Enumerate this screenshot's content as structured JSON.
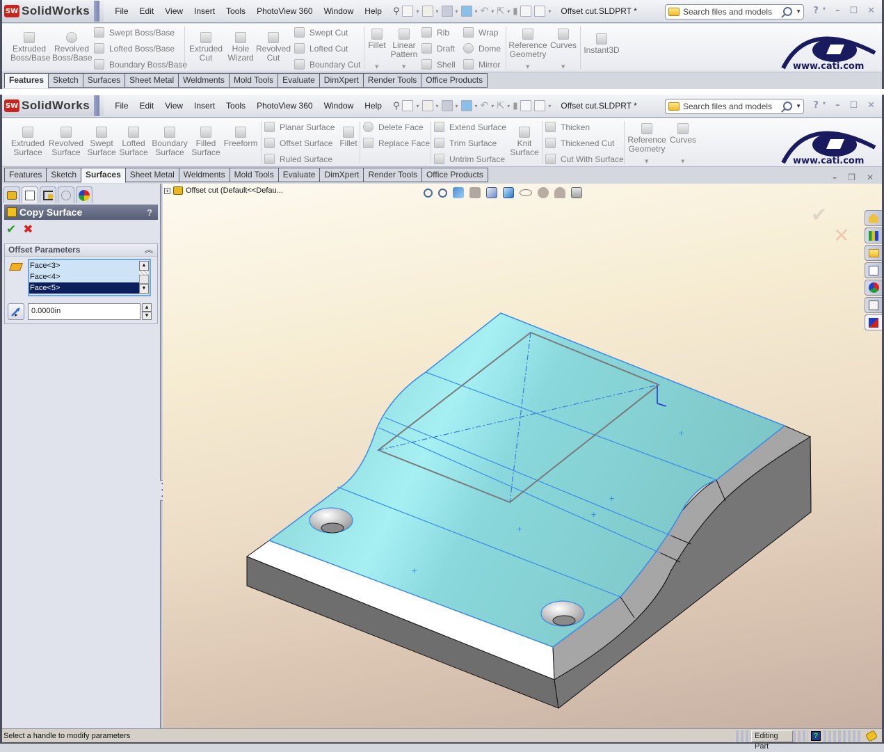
{
  "app": {
    "name": "SolidWorks",
    "logo_badge": "SW",
    "menu": [
      "File",
      "Edit",
      "View",
      "Insert",
      "Tools",
      "PhotoView 360",
      "Window",
      "Help"
    ],
    "document_title": "Offset cut.SLDPRT *",
    "search_placeholder": "Search files and models",
    "help_label": "?",
    "watermark": "www.cati.com"
  },
  "top_window": {
    "ribbon": {
      "large_buttons_left": [
        {
          "label": "Extruded Boss/Base",
          "icon": "extruded-boss-icon"
        },
        {
          "label": "Revolved Boss/Base",
          "icon": "revolved-boss-icon"
        }
      ],
      "stack_boss": [
        {
          "label": "Swept Boss/Base",
          "icon": "swept-boss-icon"
        },
        {
          "label": "Lofted Boss/Base",
          "icon": "lofted-boss-icon"
        },
        {
          "label": "Boundary Boss/Base",
          "icon": "boundary-boss-icon"
        }
      ],
      "large_buttons_cut": [
        {
          "label": "Extruded Cut",
          "icon": "extruded-cut-icon"
        },
        {
          "label": "Hole Wizard",
          "icon": "hole-wizard-icon"
        },
        {
          "label": "Revolved Cut",
          "icon": "revolved-cut-icon"
        }
      ],
      "stack_cut": [
        {
          "label": "Swept Cut",
          "icon": "swept-cut-icon"
        },
        {
          "label": "Lofted Cut",
          "icon": "lofted-cut-icon"
        },
        {
          "label": "Boundary Cut",
          "icon": "boundary-cut-icon"
        }
      ],
      "large_buttons_feat": [
        {
          "label": "Fillet",
          "icon": "fillet-icon"
        },
        {
          "label": "Linear Pattern",
          "icon": "linear-pattern-icon"
        }
      ],
      "stack_feat1": [
        {
          "label": "Rib",
          "icon": "rib-icon"
        },
        {
          "label": "Draft",
          "icon": "draft-icon"
        },
        {
          "label": "Shell",
          "icon": "shell-icon"
        }
      ],
      "stack_feat2": [
        {
          "label": "Wrap",
          "icon": "wrap-icon"
        },
        {
          "label": "Dome",
          "icon": "dome-icon"
        },
        {
          "label": "Mirror",
          "icon": "mirror-icon"
        }
      ],
      "large_buttons_ref": [
        {
          "label": "Reference Geometry",
          "icon": "reference-geometry-icon"
        },
        {
          "label": "Curves",
          "icon": "curves-icon"
        },
        {
          "label": "Instant3D",
          "icon": "instant3d-icon"
        }
      ]
    },
    "tabs": [
      {
        "label": "Features",
        "active": true
      },
      {
        "label": "Sketch"
      },
      {
        "label": "Surfaces"
      },
      {
        "label": "Sheet Metal"
      },
      {
        "label": "Weldments"
      },
      {
        "label": "Mold Tools"
      },
      {
        "label": "Evaluate"
      },
      {
        "label": "DimXpert"
      },
      {
        "label": "Render Tools"
      },
      {
        "label": "Office Products"
      }
    ]
  },
  "main_window": {
    "ribbon": {
      "large_buttons": [
        {
          "label": "Extruded Surface",
          "icon": "extruded-surface-icon"
        },
        {
          "label": "Revolved Surface",
          "icon": "revolved-surface-icon"
        },
        {
          "label": "Swept Surface",
          "icon": "swept-surface-icon"
        },
        {
          "label": "Lofted Surface",
          "icon": "lofted-surface-icon"
        },
        {
          "label": "Boundary Surface",
          "icon": "boundary-surface-icon"
        },
        {
          "label": "Filled Surface",
          "icon": "filled-surface-icon"
        },
        {
          "label": "Freeform",
          "icon": "freeform-icon"
        }
      ],
      "stack_surface": [
        {
          "label": "Planar Surface",
          "icon": "planar-surface-icon"
        },
        {
          "label": "Offset Surface",
          "icon": "offset-surface-icon"
        },
        {
          "label": "Ruled Surface",
          "icon": "ruled-surface-icon"
        }
      ],
      "fillet": {
        "label": "Fillet",
        "icon": "fillet-icon"
      },
      "stack_face": [
        {
          "label": "Delete Face",
          "icon": "delete-face-icon"
        },
        {
          "label": "Replace Face",
          "icon": "replace-face-icon"
        }
      ],
      "stack_trim": [
        {
          "label": "Extend Surface",
          "icon": "extend-surface-icon"
        },
        {
          "label": "Trim Surface",
          "icon": "trim-surface-icon"
        },
        {
          "label": "Untrim Surface",
          "icon": "untrim-surface-icon"
        }
      ],
      "knit": {
        "label": "Knit Surface",
        "icon": "knit-surface-icon"
      },
      "stack_thicken": [
        {
          "label": "Thicken",
          "icon": "thicken-icon"
        },
        {
          "label": "Thickened Cut",
          "icon": "thickened-cut-icon"
        },
        {
          "label": "Cut With Surface",
          "icon": "cut-with-surface-icon"
        }
      ],
      "ref": [
        {
          "label": "Reference Geometry",
          "icon": "reference-geometry-icon"
        },
        {
          "label": "Curves",
          "icon": "curves-icon"
        }
      ]
    },
    "tabs": [
      {
        "label": "Features"
      },
      {
        "label": "Sketch"
      },
      {
        "label": "Surfaces",
        "active": true
      },
      {
        "label": "Sheet Metal"
      },
      {
        "label": "Weldments"
      },
      {
        "label": "Mold Tools"
      },
      {
        "label": "Evaluate"
      },
      {
        "label": "DimXpert"
      },
      {
        "label": "Render Tools"
      },
      {
        "label": "Office Products"
      }
    ]
  },
  "property_manager": {
    "panel_tabs": [
      "feature-manager-tree-icon",
      "property-manager-icon",
      "configuration-manager-icon",
      "dimxpert-manager-icon",
      "display-manager-icon"
    ],
    "title": "Copy Surface",
    "help": "?",
    "ok_icon": "✔",
    "cancel_icon": "✖",
    "group_title": "Offset Parameters",
    "collapse_icon": "︽",
    "faces": [
      {
        "label": "Face<3>"
      },
      {
        "label": "Face<4>"
      },
      {
        "label": "Face<5>",
        "selected": true
      }
    ],
    "offset_value": "0.0000in"
  },
  "viewport": {
    "tree_root": "Offset cut  (Default<<Defau...",
    "heads_up_toolbar": [
      "zoom-to-fit-icon",
      "zoom-to-area-icon",
      "previous-view-icon",
      "section-view-icon",
      "view-orientation-icon",
      "display-style-icon",
      "hide-show-items-icon",
      "edit-appearance-icon",
      "apply-scene-icon",
      "view-settings-icon"
    ],
    "confirm_ok": "✔",
    "confirm_cancel": "✕",
    "task_pane": [
      "solidworks-resources-icon",
      "design-library-icon",
      "file-explorer-icon",
      "view-palette-icon",
      "appearances-scenes-icon",
      "custom-properties-icon",
      "document-recovery-icon"
    ],
    "colors": {
      "selected_face": "#7fc8c8",
      "face_highlight": "#a8f2f6",
      "edge_highlight": "#3a8ae8",
      "body_dark": "#727272",
      "body_mid": "#a8a8a8",
      "sketch": "#7a7a7a"
    }
  },
  "status_bar": {
    "message": "Select a handle to modify parameters",
    "mode": "Editing Part",
    "help_icon": "?"
  }
}
